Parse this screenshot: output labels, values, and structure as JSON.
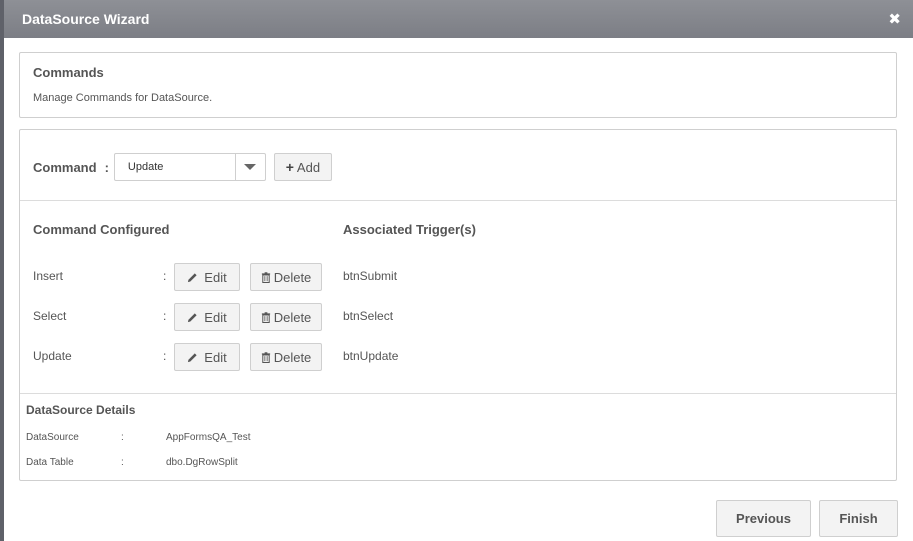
{
  "window": {
    "title": "DataSource Wizard",
    "close_glyph": "✖"
  },
  "header": {
    "title": "Commands",
    "subtitle": "Manage Commands for DataSource."
  },
  "command_picker": {
    "label": "Command",
    "colon": ":",
    "selected": "Update",
    "add_label": "Add"
  },
  "table": {
    "col_command": "Command Configured",
    "col_trigger": "Associated Trigger(s)",
    "colon": ":",
    "edit_label": "Edit",
    "delete_label": "Delete",
    "rows": [
      {
        "command": "Insert",
        "trigger": "btnSubmit"
      },
      {
        "command": "Select",
        "trigger": "btnSelect"
      },
      {
        "command": "Update",
        "trigger": "btnUpdate"
      }
    ]
  },
  "details": {
    "title": "DataSource Details",
    "colon": ":",
    "rows": [
      {
        "key": "DataSource",
        "value": "AppFormsQA_Test"
      },
      {
        "key": "Data Table",
        "value": "dbo.DgRowSplit"
      }
    ]
  },
  "footer": {
    "previous_label": "Previous",
    "finish_label": "Finish"
  },
  "icons": {
    "add": "plus-icon",
    "edit": "pencil-icon",
    "delete": "trash-icon",
    "dropdown": "chevron-down-icon",
    "close": "close-icon"
  },
  "colors": {
    "titlebar": "#828389",
    "border": "#cfcfcf",
    "button_bg": "#f3f3f3",
    "text": "#555555"
  }
}
